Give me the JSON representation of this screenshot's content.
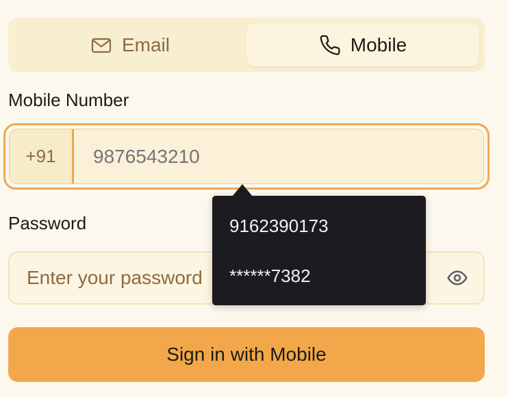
{
  "tabs": {
    "email_label": "Email",
    "mobile_label": "Mobile",
    "active": "Mobile"
  },
  "mobile": {
    "label": "Mobile Number",
    "country_code": "+91",
    "placeholder": "9876543210"
  },
  "password": {
    "label": "Password",
    "placeholder": "Enter your password"
  },
  "submit_label": "Sign in with Mobile",
  "autofill": {
    "items": [
      "9162390173",
      "******7382"
    ]
  },
  "colors": {
    "background": "#fcf8ee",
    "accent": "#f2a84a",
    "focus_ring": "#eea850",
    "dropdown_bg": "#1c1b1f",
    "muted_text": "#8e6a42"
  },
  "icons": {
    "email_tab": "mail-icon",
    "mobile_tab": "phone-icon",
    "password_toggle": "eye-icon"
  }
}
